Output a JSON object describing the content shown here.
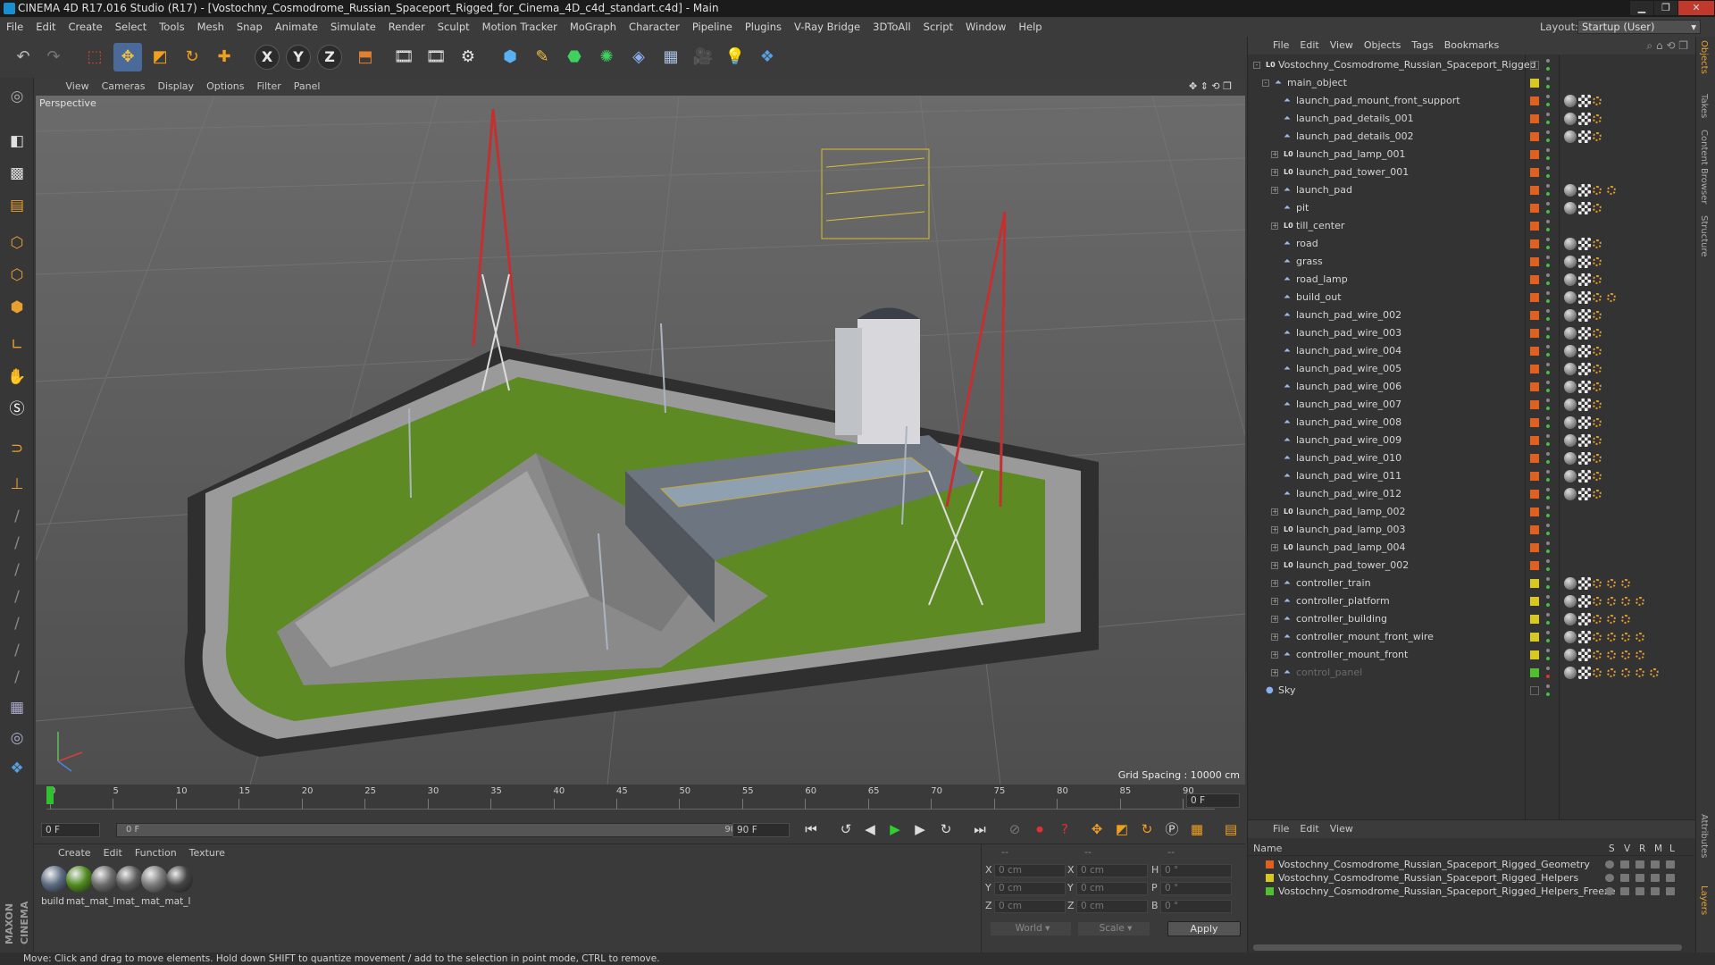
{
  "window": {
    "title": "CINEMA 4D R17.016 Studio (R17) - [Vostochny_Cosmodrome_Russian_Spaceport_Rigged_for_Cinema_4D_c4d_standart.c4d] - Main",
    "controls": [
      "minimize-icon",
      "maximize-icon",
      "close-icon"
    ]
  },
  "menubar": [
    "File",
    "Edit",
    "Create",
    "Select",
    "Tools",
    "Mesh",
    "Snap",
    "Animate",
    "Simulate",
    "Render",
    "Sculpt",
    "Motion Tracker",
    "MoGraph",
    "Character",
    "Pipeline",
    "Plugins",
    "V-Ray Bridge",
    "3DToAll",
    "Script",
    "Window",
    "Help"
  ],
  "layout": {
    "label": "Layout:",
    "value": "Startup (User)"
  },
  "toolbar": {
    "axis_x": "X",
    "axis_y": "Y",
    "axis_z": "Z"
  },
  "viewport": {
    "menu": [
      "View",
      "Cameras",
      "Display",
      "Options",
      "Filter",
      "Panel"
    ],
    "camera_label": "Perspective",
    "grid_spacing": "Grid Spacing : 10000 cm"
  },
  "timeline": {
    "ticks": [
      "0",
      "5",
      "10",
      "15",
      "20",
      "25",
      "30",
      "35",
      "40",
      "45",
      "50",
      "55",
      "60",
      "65",
      "70",
      "75",
      "80",
      "85",
      "90"
    ],
    "current_frame": "0 F",
    "start_field": "0 F",
    "range_start": "0 F",
    "range_end": "90 F",
    "end_field": "90 F"
  },
  "materials": {
    "menu": [
      "Create",
      "Edit",
      "Function",
      "Texture"
    ],
    "items": [
      {
        "label": "build",
        "color": "#5a6a80"
      },
      {
        "label": "mat_",
        "color": "#4f8a1e"
      },
      {
        "label": "mat_l",
        "color": "#6a6a6a"
      },
      {
        "label": "mat_",
        "color": "#5a5a5a"
      },
      {
        "label": "mat_",
        "color": "#7a7a7a"
      },
      {
        "label": "mat_l",
        "color": "#444444"
      }
    ]
  },
  "coordinates": {
    "headers": [
      "--",
      "--",
      "--"
    ],
    "rows": [
      {
        "a": "X",
        "av": "0 cm",
        "b": "X",
        "bv": "0 cm",
        "c": "H",
        "cv": "0 °"
      },
      {
        "a": "Y",
        "av": "0 cm",
        "b": "Y",
        "bv": "0 cm",
        "c": "P",
        "cv": "0 °"
      },
      {
        "a": "Z",
        "av": "0 cm",
        "b": "Z",
        "bv": "0 cm",
        "c": "B",
        "cv": "0 °"
      }
    ],
    "mode": "World",
    "scale": "Scale",
    "apply": "Apply"
  },
  "objects": {
    "menu": [
      "File",
      "Edit",
      "View",
      "Objects",
      "Tags",
      "Bookmarks"
    ],
    "items": [
      {
        "name": "Vostochny_Cosmodrome_Russian_Spaceport_Rigged",
        "depth": 0,
        "type": "null",
        "expand": "-",
        "layer": "",
        "tags": 0
      },
      {
        "name": "main_object",
        "depth": 1,
        "type": "bone",
        "expand": "-",
        "layer": "#d8c820",
        "tags": 0
      },
      {
        "name": "launch_pad_mount_front_support",
        "depth": 2,
        "type": "bone",
        "expand": "",
        "layer": "#e06020",
        "tags": 3
      },
      {
        "name": "launch_pad_details_001",
        "depth": 2,
        "type": "bone",
        "expand": "",
        "layer": "#e06020",
        "tags": 3
      },
      {
        "name": "launch_pad_details_002",
        "depth": 2,
        "type": "bone",
        "expand": "",
        "layer": "#e06020",
        "tags": 3
      },
      {
        "name": "launch_pad_lamp_001",
        "depth": 2,
        "type": "null",
        "expand": "+",
        "layer": "#e06020",
        "tags": 0
      },
      {
        "name": "launch_pad_tower_001",
        "depth": 2,
        "type": "null",
        "expand": "+",
        "layer": "#e06020",
        "tags": 0
      },
      {
        "name": "launch_pad",
        "depth": 2,
        "type": "bone",
        "expand": "+",
        "layer": "#e06020",
        "tags": 4
      },
      {
        "name": "pit",
        "depth": 2,
        "type": "bone",
        "expand": "",
        "layer": "#e06020",
        "tags": 3
      },
      {
        "name": "till_center",
        "depth": 2,
        "type": "null",
        "expand": "+",
        "layer": "#e06020",
        "tags": 0
      },
      {
        "name": "road",
        "depth": 2,
        "type": "bone",
        "expand": "",
        "layer": "#e06020",
        "tags": 3
      },
      {
        "name": "grass",
        "depth": 2,
        "type": "bone",
        "expand": "",
        "layer": "#e06020",
        "tags": 3
      },
      {
        "name": "road_lamp",
        "depth": 2,
        "type": "bone",
        "expand": "",
        "layer": "#e06020",
        "tags": 3
      },
      {
        "name": "build_out",
        "depth": 2,
        "type": "bone",
        "expand": "",
        "layer": "#e06020",
        "tags": 4
      },
      {
        "name": "launch_pad_wire_002",
        "depth": 2,
        "type": "bone",
        "expand": "",
        "layer": "#e06020",
        "tags": 3
      },
      {
        "name": "launch_pad_wire_003",
        "depth": 2,
        "type": "bone",
        "expand": "",
        "layer": "#e06020",
        "tags": 3
      },
      {
        "name": "launch_pad_wire_004",
        "depth": 2,
        "type": "bone",
        "expand": "",
        "layer": "#e06020",
        "tags": 3
      },
      {
        "name": "launch_pad_wire_005",
        "depth": 2,
        "type": "bone",
        "expand": "",
        "layer": "#e06020",
        "tags": 3
      },
      {
        "name": "launch_pad_wire_006",
        "depth": 2,
        "type": "bone",
        "expand": "",
        "layer": "#e06020",
        "tags": 3
      },
      {
        "name": "launch_pad_wire_007",
        "depth": 2,
        "type": "bone",
        "expand": "",
        "layer": "#e06020",
        "tags": 3
      },
      {
        "name": "launch_pad_wire_008",
        "depth": 2,
        "type": "bone",
        "expand": "",
        "layer": "#e06020",
        "tags": 3
      },
      {
        "name": "launch_pad_wire_009",
        "depth": 2,
        "type": "bone",
        "expand": "",
        "layer": "#e06020",
        "tags": 3
      },
      {
        "name": "launch_pad_wire_010",
        "depth": 2,
        "type": "bone",
        "expand": "",
        "layer": "#e06020",
        "tags": 3
      },
      {
        "name": "launch_pad_wire_011",
        "depth": 2,
        "type": "bone",
        "expand": "",
        "layer": "#e06020",
        "tags": 3
      },
      {
        "name": "launch_pad_wire_012",
        "depth": 2,
        "type": "bone",
        "expand": "",
        "layer": "#e06020",
        "tags": 3
      },
      {
        "name": "launch_pad_lamp_002",
        "depth": 2,
        "type": "null",
        "expand": "+",
        "layer": "#e06020",
        "tags": 0
      },
      {
        "name": "launch_pad_lamp_003",
        "depth": 2,
        "type": "null",
        "expand": "+",
        "layer": "#e06020",
        "tags": 0
      },
      {
        "name": "launch_pad_lamp_004",
        "depth": 2,
        "type": "null",
        "expand": "+",
        "layer": "#e06020",
        "tags": 0
      },
      {
        "name": "launch_pad_tower_002",
        "depth": 2,
        "type": "null",
        "expand": "+",
        "layer": "#e06020",
        "tags": 0
      },
      {
        "name": "controller_train",
        "depth": 2,
        "type": "bone",
        "expand": "+",
        "layer": "#d8c820",
        "tags": 5
      },
      {
        "name": "controller_platform",
        "depth": 2,
        "type": "bone",
        "expand": "+",
        "layer": "#d8c820",
        "tags": 6
      },
      {
        "name": "controller_building",
        "depth": 2,
        "type": "bone",
        "expand": "+",
        "layer": "#d8c820",
        "tags": 5
      },
      {
        "name": "controller_mount_front_wire",
        "depth": 2,
        "type": "bone",
        "expand": "+",
        "layer": "#d8c820",
        "tags": 6
      },
      {
        "name": "controller_mount_front",
        "depth": 2,
        "type": "bone",
        "expand": "+",
        "layer": "#d8c820",
        "tags": 6
      },
      {
        "name": "control_panel",
        "depth": 2,
        "type": "bone",
        "expand": "+",
        "layer": "#50c030",
        "tags": 7,
        "dim": true
      },
      {
        "name": "Sky",
        "depth": 0,
        "type": "sky",
        "expand": "",
        "layer": "",
        "tags": 0
      }
    ]
  },
  "layers": {
    "menu": [
      "File",
      "Edit",
      "View"
    ],
    "header_name": "Name",
    "header_cols": [
      "S",
      "V",
      "R",
      "M",
      "L"
    ],
    "items": [
      {
        "name": "Vostochny_Cosmodrome_Russian_Spaceport_Rigged_Geometry",
        "color": "#e06020"
      },
      {
        "name": "Vostochny_Cosmodrome_Russian_Spaceport_Rigged_Helpers",
        "color": "#d8c820"
      },
      {
        "name": "Vostochny_Cosmodrome_Russian_Spaceport_Rigged_Helpers_Freeze",
        "color": "#50c030"
      }
    ]
  },
  "side_tabs": [
    "Objects",
    "Takes",
    "Content Browser",
    "Structure",
    "Attributes",
    "Layers"
  ],
  "status": "Move: Click and drag to move elements. Hold down SHIFT to quantize movement / add to the selection in point mode, CTRL to remove.",
  "brand": "MAXON CINEMA 4D"
}
